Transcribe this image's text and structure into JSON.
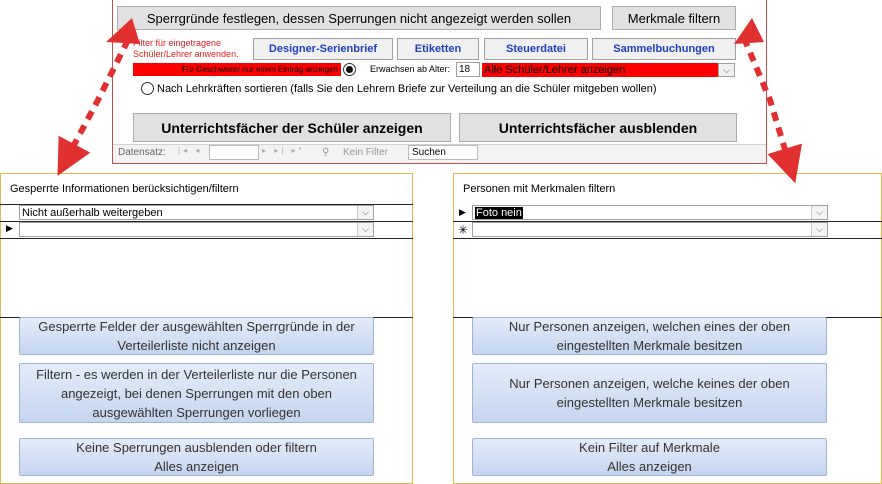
{
  "top": {
    "sperr_button": "Sperrgründe festlegen, dessen Sperrungen nicht angezeigt werden sollen",
    "merkmale_button": "Merkmale filtern",
    "filter_note": "Filter für eingetragene Schüler/Lehrer anwenden.",
    "tabs": [
      "Designer-Serienbrief",
      "Etiketten",
      "Steuerdatei",
      "Sammelbuchungen"
    ],
    "geschwister_label": "Für Geschwister nur einen Eintrag anzeigen",
    "erwachsen_label": "Erwachsen ab Alter:",
    "erwachsen_value": "18",
    "show_combo_value": "Alle Schüler/Lehrer anzeigen",
    "sort_label": "Nach Lehrkräften sortieren (falls Sie den Lehrern Briefe zur Verteilung an die Schüler mitgeben wollen)",
    "btn_show_subjects": "Unterrichtsfächer der Schüler anzeigen",
    "btn_hide_subjects": "Unterrichtsfächer ausblenden"
  },
  "nav": {
    "label": "Datensatz:",
    "filter": "Kein Filter",
    "search": "Suchen"
  },
  "left_panel": {
    "title": "Gesperrte Informationen berücksichtigen/filtern",
    "row1": "Nicht außerhalb weitergeben",
    "row2": "",
    "btn1": "Gesperrte Felder der ausgewählten Sperrgründe in der Verteilerliste nicht anzeigen",
    "btn2": "Filtern - es werden in der Verteilerliste nur die Personen angezeigt, bei denen Sperrungen mit den oben ausgewählten Sperrungen vorliegen",
    "btn3_line1": "Keine Sperrungen ausblenden oder filtern",
    "btn3_line2": "Alles anzeigen"
  },
  "right_panel": {
    "title": "Personen mit Merkmalen filtern",
    "row1": "Foto nein",
    "row2": "",
    "btn1": "Nur Personen anzeigen, welchen eines der oben eingestellten Merkmale besitzen",
    "btn2": "Nur Personen anzeigen, welche keines der oben eingestellten Merkmale besitzen",
    "btn3_line1": "Kein Filter auf Merkmale",
    "btn3_line2": "Alles anzeigen"
  },
  "colors": {
    "accent_red": "#ff0000",
    "tab_text": "#1f3fbf",
    "panel_border": "#e8b84a",
    "arrow": "#e03030"
  }
}
